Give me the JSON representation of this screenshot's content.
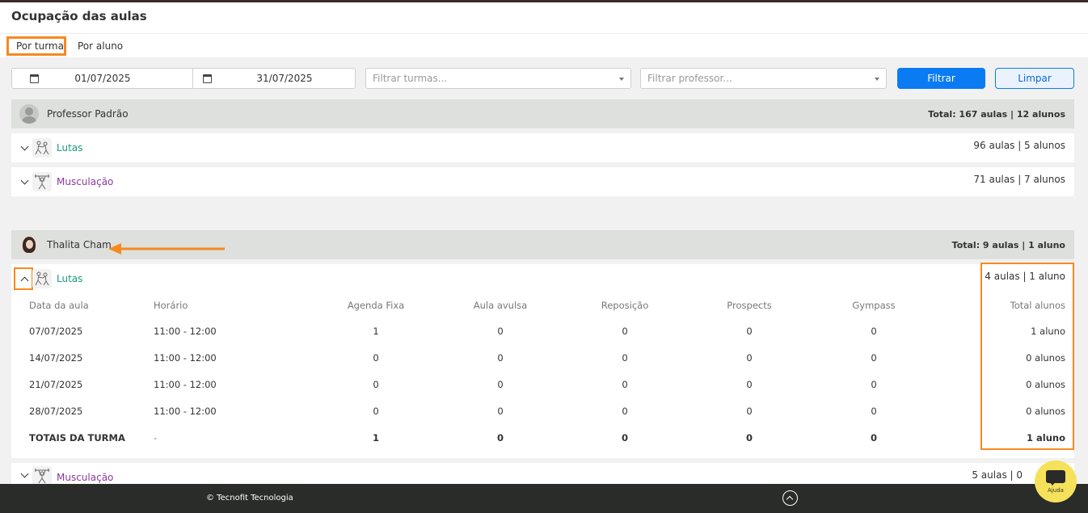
{
  "page": {
    "title": "Ocupação das aulas"
  },
  "tabs": [
    {
      "label": "Por turma",
      "active": true
    },
    {
      "label": "Por aluno",
      "active": false
    }
  ],
  "filters": {
    "date_start": "01/07/2025",
    "date_end": "31/07/2025",
    "classes_placeholder": "Filtrar turmas...",
    "teacher_placeholder": "Filtrar professor...",
    "filter_label": "Filtrar",
    "clear_label": "Limpar"
  },
  "professors": [
    {
      "name": "Professor Padrão",
      "total": "Total: 167 aulas | 12 alunos",
      "classes": [
        {
          "name": "Lutas",
          "total": "96 aulas | 5 alunos",
          "icon": "martial-arts-icon"
        },
        {
          "name": "Musculação",
          "total": "71 aulas | 7 alunos",
          "icon": "weightlifting-icon"
        }
      ]
    },
    {
      "name": "Thalita Cham",
      "total": "Total: 9 aulas | 1 aluno",
      "classes": [
        {
          "name": "Lutas",
          "total": "4 aulas | 1 aluno",
          "icon": "martial-arts-icon",
          "expanded": true,
          "columns": [
            "Data da aula",
            "Horário",
            "Agenda Fixa",
            "Aula avulsa",
            "Reposição",
            "Prospects",
            "Gympass",
            "Total alunos"
          ],
          "rows": [
            [
              "07/07/2025",
              "11:00 - 12:00",
              "1",
              "0",
              "0",
              "0",
              "0",
              "1 aluno"
            ],
            [
              "14/07/2025",
              "11:00 - 12:00",
              "0",
              "0",
              "0",
              "0",
              "0",
              "0 alunos"
            ],
            [
              "21/07/2025",
              "11:00 - 12:00",
              "0",
              "0",
              "0",
              "0",
              "0",
              "0 alunos"
            ],
            [
              "28/07/2025",
              "11:00 - 12:00",
              "0",
              "0",
              "0",
              "0",
              "0",
              "0 alunos"
            ]
          ],
          "totals": [
            "TOTAIS DA TURMA",
            "-",
            "1",
            "0",
            "0",
            "0",
            "0",
            "1 aluno"
          ]
        },
        {
          "name": "Musculação",
          "total": "5 aulas | 0",
          "icon": "weightlifting-icon"
        }
      ]
    }
  ],
  "footer": {
    "copyright": "© Tecnofit Tecnologia"
  },
  "help": {
    "label": "Ajuda"
  },
  "colors": {
    "primary": "#0b7bf4",
    "highlight": "#f7891f",
    "lutas": "#1a9a7f",
    "musculacao": "#8a3a9e"
  }
}
